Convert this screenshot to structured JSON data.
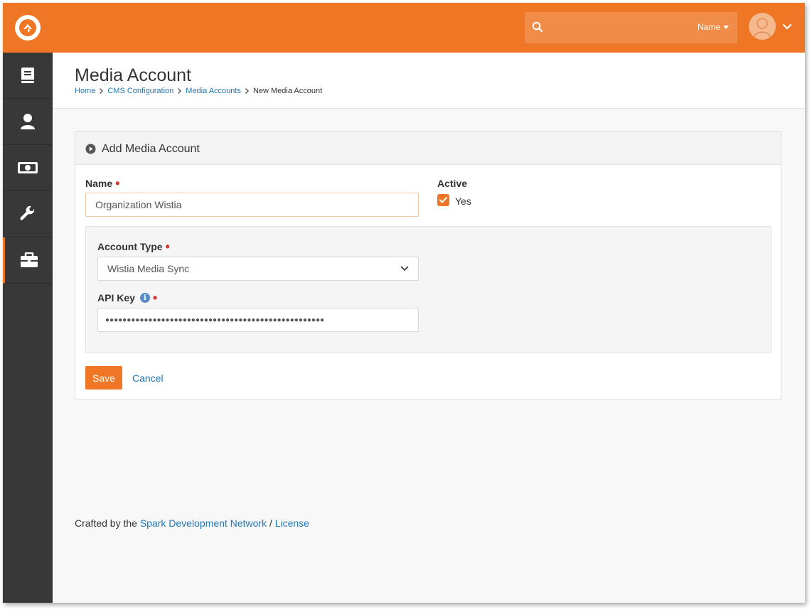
{
  "header": {
    "search_scope": "Name",
    "search_placeholder": ""
  },
  "sidebar": {
    "items": [
      {
        "icon": "book-icon"
      },
      {
        "icon": "person-icon"
      },
      {
        "icon": "money-icon"
      },
      {
        "icon": "wrench-icon"
      },
      {
        "icon": "briefcase-icon",
        "active": true
      }
    ]
  },
  "page": {
    "title": "Media Account",
    "breadcrumb": [
      "Home",
      "CMS Configuration",
      "Media Accounts",
      "New Media Account"
    ]
  },
  "panel": {
    "title": "Add Media Account",
    "name_label": "Name",
    "name_value": "Organization Wistia",
    "active_label": "Active",
    "active_option": "Yes",
    "active_checked": true,
    "account_type_label": "Account Type",
    "account_type_value": "Wistia Media Sync",
    "api_key_label": "API Key",
    "api_key_value": "●●●●●●●●●●●●●●●●●●●●●●●●●●●●●●●●●●●●●●●●●●●●●●●●●●●",
    "save_label": "Save",
    "cancel_label": "Cancel"
  },
  "footer": {
    "prefix": "Crafted by the",
    "link": "Spark Development Network",
    "separator": "/",
    "license": "License"
  },
  "colors": {
    "accent": "#ee7625",
    "sidebar": "#383838",
    "link": "#1f79b7",
    "required": "#d9342b"
  }
}
